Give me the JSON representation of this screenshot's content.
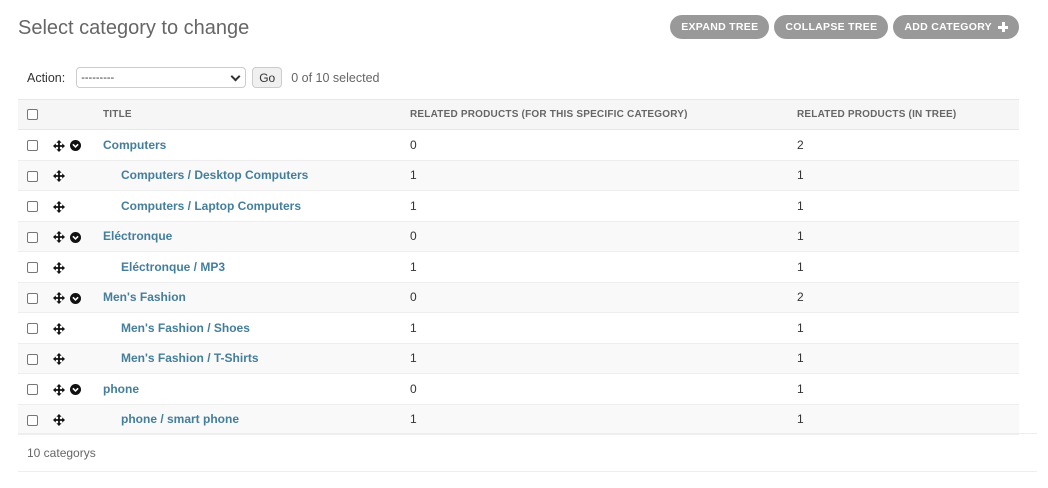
{
  "header": {
    "title": "Select category to change"
  },
  "tools": {
    "expand_label": "EXPAND TREE",
    "collapse_label": "COLLAPSE TREE",
    "add_label": "ADD CATEGORY"
  },
  "actions": {
    "label": "Action:",
    "selected_value": "---------",
    "go_label": "Go",
    "selection_counter": "0 of 10 selected"
  },
  "table": {
    "headers": {
      "title": "TITLE",
      "related_specific": "RELATED PRODUCTS (FOR THIS SPECIFIC CATEGORY)",
      "related_tree": "RELATED PRODUCTS (IN TREE)"
    },
    "rows": [
      {
        "title": "Computers",
        "related_specific": "0",
        "related_tree": "2"
      },
      {
        "title": "Computers / Desktop Computers",
        "related_specific": "1",
        "related_tree": "1"
      },
      {
        "title": "Computers / Laptop Computers",
        "related_specific": "1",
        "related_tree": "1"
      },
      {
        "title": "Eléctronque",
        "related_specific": "0",
        "related_tree": "1"
      },
      {
        "title": "Eléctronque / MP3",
        "related_specific": "1",
        "related_tree": "1"
      },
      {
        "title": "Men's Fashion",
        "related_specific": "0",
        "related_tree": "2"
      },
      {
        "title": "Men's Fashion / Shoes",
        "related_specific": "1",
        "related_tree": "1"
      },
      {
        "title": "Men's Fashion / T-Shirts",
        "related_specific": "1",
        "related_tree": "1"
      },
      {
        "title": "phone",
        "related_specific": "0",
        "related_tree": "1"
      },
      {
        "title": "phone / smart phone",
        "related_specific": "1",
        "related_tree": "1"
      }
    ]
  },
  "paginator": {
    "text": "10 categorys"
  },
  "colors": {
    "link": "#447e9b",
    "tool_button": "#999999"
  },
  "icons": {
    "move": "move-icon",
    "toggle": "chevron-circle-down-icon",
    "add": "plus-icon"
  }
}
